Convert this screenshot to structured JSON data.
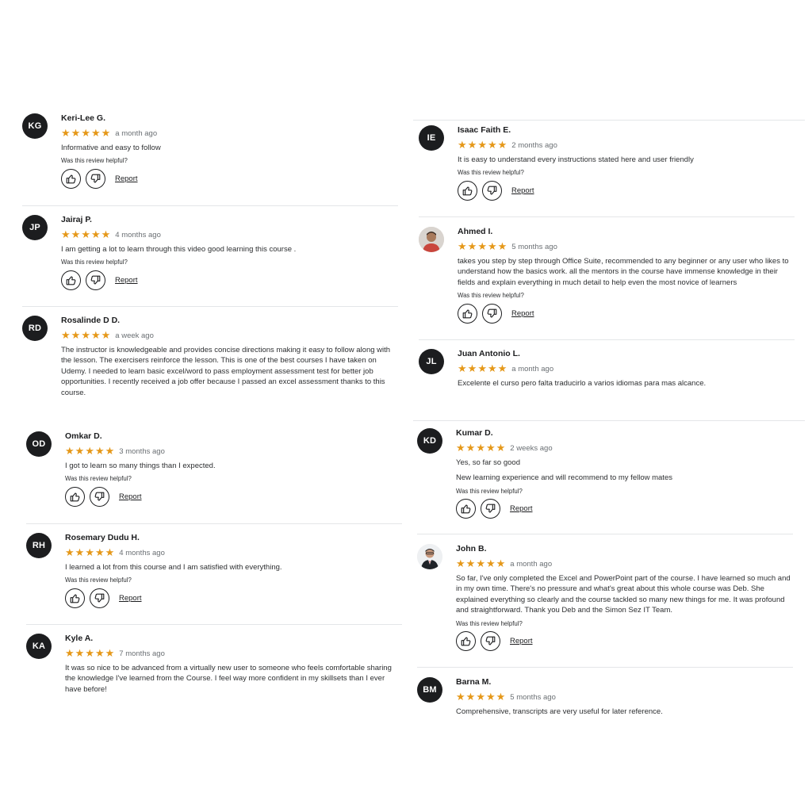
{
  "common": {
    "helpful_prompt": "Was this review helpful?",
    "report_label": "Report",
    "star_color": "#e59819"
  },
  "left_reviews": [
    {
      "initials": "KG",
      "name": "Keri-Lee G.",
      "rating": 5,
      "date": "a month ago",
      "text": "Informative and easy to follow"
    },
    {
      "initials": "JP",
      "name": "Jairaj P.",
      "rating": 5,
      "date": "4 months ago",
      "text": "I am getting a lot to learn through this video good learning this course ."
    },
    {
      "initials": "RD",
      "name": "Rosalinde D D.",
      "rating": 5,
      "date": "a week ago",
      "text": "The instructor is knowledgeable and provides concise directions making it easy to follow along with the lesson. The exercisers reinforce the lesson. This is one of the best courses I have taken on Udemy. I needed to learn basic excel/word to pass employment assessment test for better job opportunities. I recently received a job offer because I passed an excel assessment thanks to this course."
    },
    {
      "initials": "OD",
      "name": "Omkar D.",
      "rating": 5,
      "date": "3 months ago",
      "text": "I got to learn so many things than I expected."
    },
    {
      "initials": "RH",
      "name": "Rosemary Dudu H.",
      "rating": 5,
      "date": "4 months ago",
      "text": "I learned a lot from this course and I am satisfied with everything."
    },
    {
      "initials": "KA",
      "name": "Kyle A.",
      "rating": 5,
      "date": "7 months ago",
      "text": "It was so nice to be advanced from a virtually new user to someone who feels comfortable sharing the knowledge I've learned from the Course. I feel way more confident in my skillsets than I ever have before!"
    }
  ],
  "right_reviews": [
    {
      "initials": "IE",
      "name": "Isaac Faith E.",
      "rating": 5,
      "date": "2 months ago",
      "text": "It is easy to understand every instructions stated here and user friendly"
    },
    {
      "initials": "",
      "avatar": "photo",
      "name": "Ahmed I.",
      "rating": 5,
      "date": "5 months ago",
      "text": "takes you step by step through Office Suite, recommended to any beginner or any user who likes to understand how the basics work. all the mentors in the course have immense knowledge in their fields and explain everything in much detail to help even the most novice of learners"
    },
    {
      "initials": "JL",
      "name": "Juan Antonio L.",
      "rating": 5,
      "date": "a month ago",
      "text": "Excelente el curso pero falta traducirlo a varios idiomas para mas alcance."
    },
    {
      "initials": "KD",
      "name": "Kumar D.",
      "rating": 5,
      "date": "2 weeks ago",
      "text": "Yes, so far so good",
      "text2": "New learning experience and will recommend to my fellow mates"
    },
    {
      "initials": "",
      "avatar": "photo",
      "name": "John B.",
      "rating": 5,
      "date": "a month ago",
      "text": "So far, I've only completed the Excel and PowerPoint part of the course. I have learned so much and in my own time. There's no pressure and what's great about this whole course was Deb. She explained everything so clearly and the course tackled so many new things for me. It was profound and straightforward. Thank you Deb and the Simon Sez IT Team."
    },
    {
      "initials": "BM",
      "name": "Barna M.",
      "rating": 5,
      "date": "5 months ago",
      "text": "Comprehensive, transcripts are very useful for later reference."
    }
  ]
}
